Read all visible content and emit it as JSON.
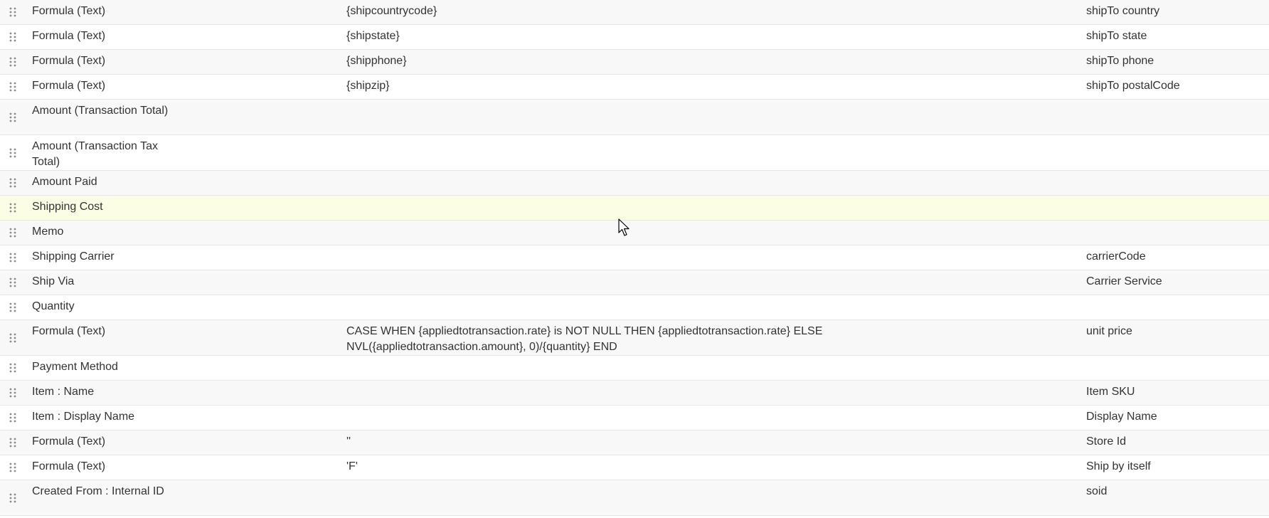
{
  "rows": [
    {
      "field": "Formula (Text)",
      "formula": "{shipcountrycode}",
      "summary": "shipTo country"
    },
    {
      "field": "Formula (Text)",
      "formula": "{shipstate}",
      "summary": "shipTo state"
    },
    {
      "field": "Formula (Text)",
      "formula": "{shipphone}",
      "summary": "shipTo phone"
    },
    {
      "field": "Formula (Text)",
      "formula": "{shipzip}",
      "summary": "shipTo postalCode"
    },
    {
      "field": "Amount (Transaction Total)",
      "formula": "",
      "summary": ""
    },
    {
      "field": "Amount (Transaction Tax Total)",
      "formula": "",
      "summary": ""
    },
    {
      "field": "Amount Paid",
      "formula": "",
      "summary": ""
    },
    {
      "field": "Shipping Cost",
      "formula": "",
      "summary": ""
    },
    {
      "field": "Memo",
      "formula": "",
      "summary": ""
    },
    {
      "field": "Shipping Carrier",
      "formula": "",
      "summary": "carrierCode"
    },
    {
      "field": "Ship Via",
      "formula": "",
      "summary": "Carrier Service"
    },
    {
      "field": "Quantity",
      "formula": "",
      "summary": ""
    },
    {
      "field": "Formula (Text)",
      "formula": "CASE WHEN {appliedtotransaction.rate} is NOT NULL THEN {appliedtotransaction.rate} ELSE NVL({appliedtotransaction.amount}, 0)/{quantity} END",
      "summary": "unit price"
    },
    {
      "field": "Payment Method",
      "formula": "",
      "summary": ""
    },
    {
      "field": "Item : Name",
      "formula": "",
      "summary": "Item SKU"
    },
    {
      "field": "Item : Display Name",
      "formula": "",
      "summary": "Display Name"
    },
    {
      "field": "Formula (Text)",
      "formula": "''",
      "summary": "Store Id"
    },
    {
      "field": "Formula (Text)",
      "formula": "'F'",
      "summary": "Ship by itself"
    },
    {
      "field": "Created From : Internal ID",
      "formula": "",
      "summary": "soid"
    }
  ],
  "icons": {
    "drag_handle": "drag-handle-icon",
    "cursor": "mouse-pointer-icon"
  },
  "colors": {
    "highlight_row": "#fbfde5",
    "odd_row": "#f8f8f8",
    "border": "#e6e6e6",
    "handle": "#8a8a8a"
  }
}
